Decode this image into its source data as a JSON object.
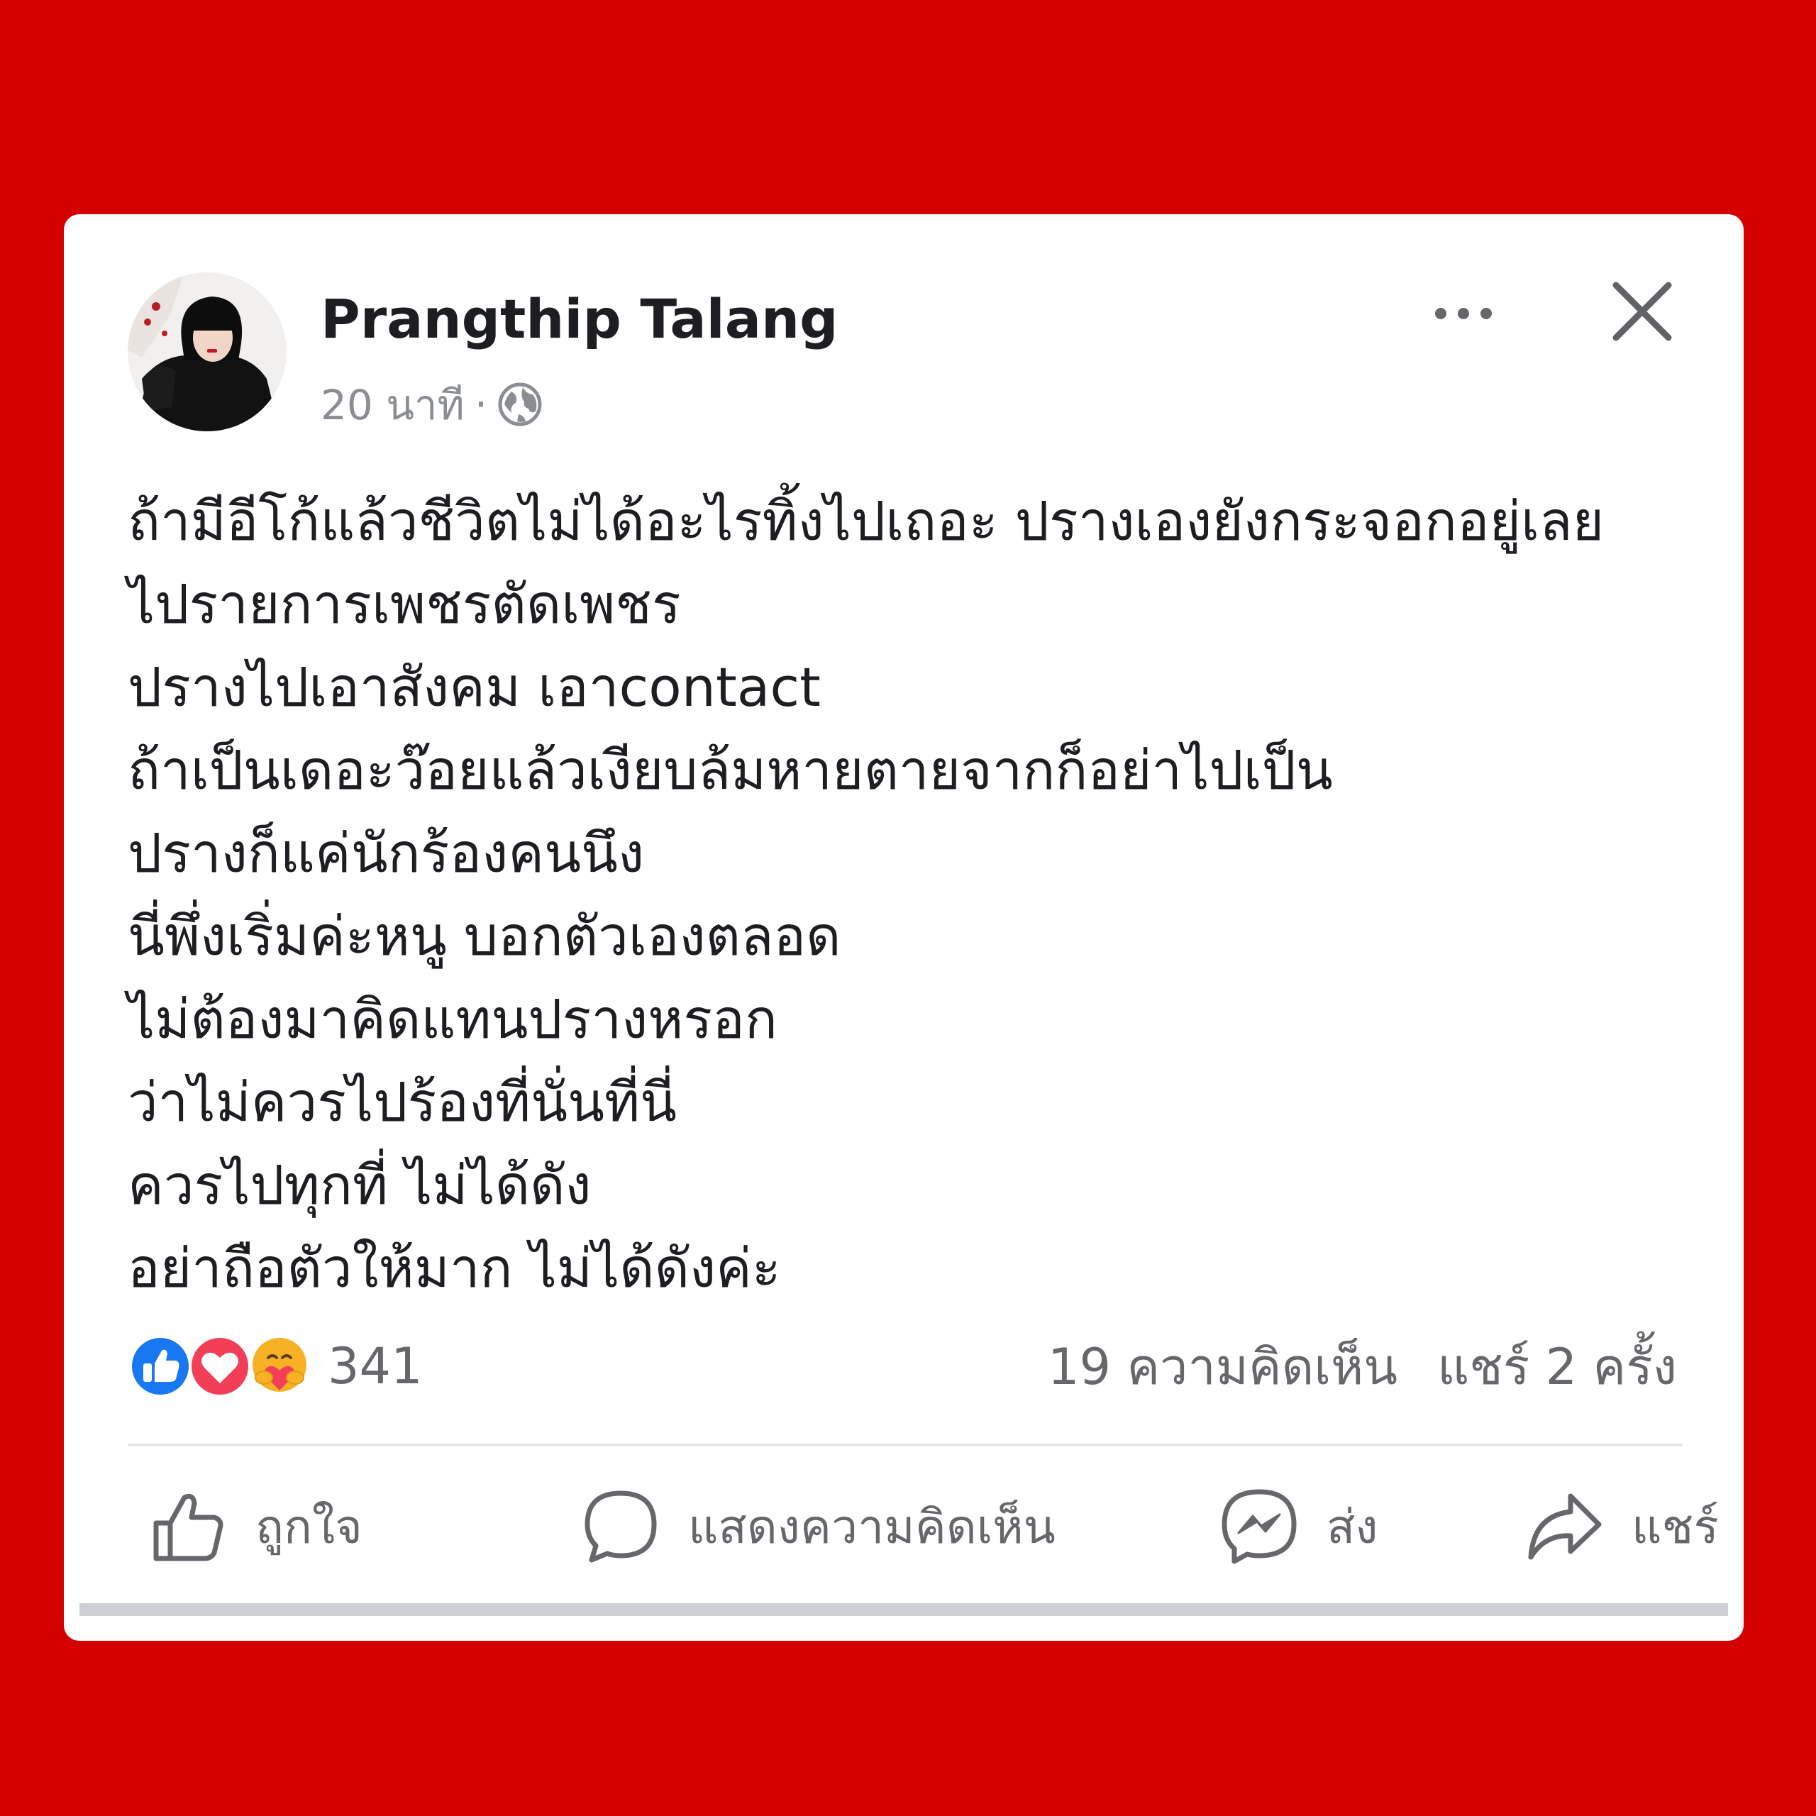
{
  "post": {
    "author": "Prangthip Talang",
    "time": "20 นาที",
    "separator": "·",
    "privacy_icon": "globe-icon",
    "lines": [
      "ถ้ามีอีโก้แล้วชีวิตไม่ได้อะไรทิ้งไปเถอะ ปรางเองยังกระจอกอยู่เลย",
      "ไปรายการเพชรตัดเพชร",
      "ปรางไปเอาสังคม เอาcontact",
      "ถ้าเป็นเดอะว๊อยแล้วเงียบล้มหายตายจากก็อย่าไปเป็น",
      "ปรางก็แค่นักร้องคนนึง",
      "นี่พึ่งเริ่มค่ะหนู บอกตัวเองตลอด",
      "ไม่ต้องมาคิดแทนปรางหรอก",
      "ว่าไม่ควรไปร้องที่นั่นที่นี่",
      "ควรไปทุกที่ ไม่ได้ดัง",
      "อย่าถือตัวให้มาก ไม่ได้ดังค่ะ"
    ]
  },
  "reactions": {
    "icons": [
      "like-reaction-icon",
      "love-reaction-icon",
      "care-reaction-icon"
    ],
    "count": "341"
  },
  "stats": {
    "comments": "19 ความคิดเห็น",
    "shares": "แชร์ 2 ครั้ง"
  },
  "actions": {
    "like": "ถูกใจ",
    "comment": "แสดงความคิดเห็น",
    "send": "ส่ง",
    "share": "แชร์"
  },
  "colors": {
    "background": "#d40000",
    "card": "#ffffff",
    "like_blue": "#1877f2",
    "love_red": "#f33e58",
    "care_yellow": "#f7b125",
    "secondary_text": "#65676b"
  }
}
